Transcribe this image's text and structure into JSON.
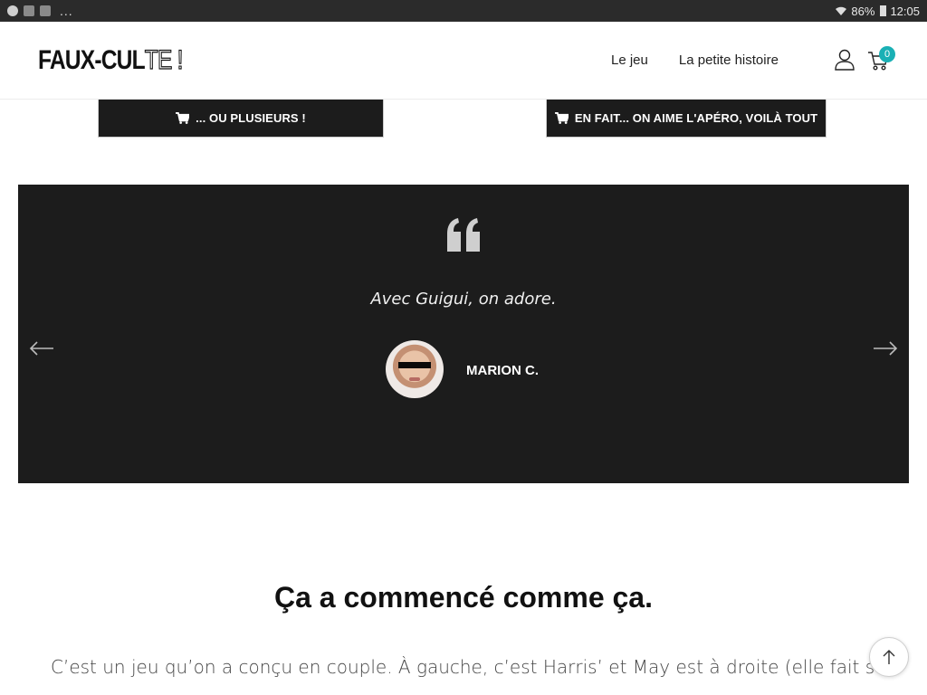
{
  "statusbar": {
    "overflow": "...",
    "battery": "86%",
    "time": "12:05",
    "icons": [
      "notification-icon",
      "app-icon",
      "app-icon",
      "wifi-icon",
      "battery-icon"
    ]
  },
  "header": {
    "logo_solid": "FAUX-CUL",
    "logo_outline": "TE !",
    "nav": [
      {
        "label": "Le jeu"
      },
      {
        "label": "La petite histoire"
      }
    ],
    "cart_count": "0",
    "accent_color": "#1ab0b5"
  },
  "buttons": {
    "left_label": "... OU PLUSIEURS !",
    "right_label": "EN FAIT... ON AIME L'APÉRO, VOILÀ TOUT",
    "icon": "cart-icon"
  },
  "testimonial": {
    "quote": "Avec Guigui, on adore.",
    "author": "MARION C.",
    "background": "#1c1c1c"
  },
  "story": {
    "title": "Ça a commencé comme ça.",
    "body": "C’est un jeu qu’on a conçu en couple. À gauche, c’est Harris’ et May est à droite (elle fait semblant de"
  }
}
